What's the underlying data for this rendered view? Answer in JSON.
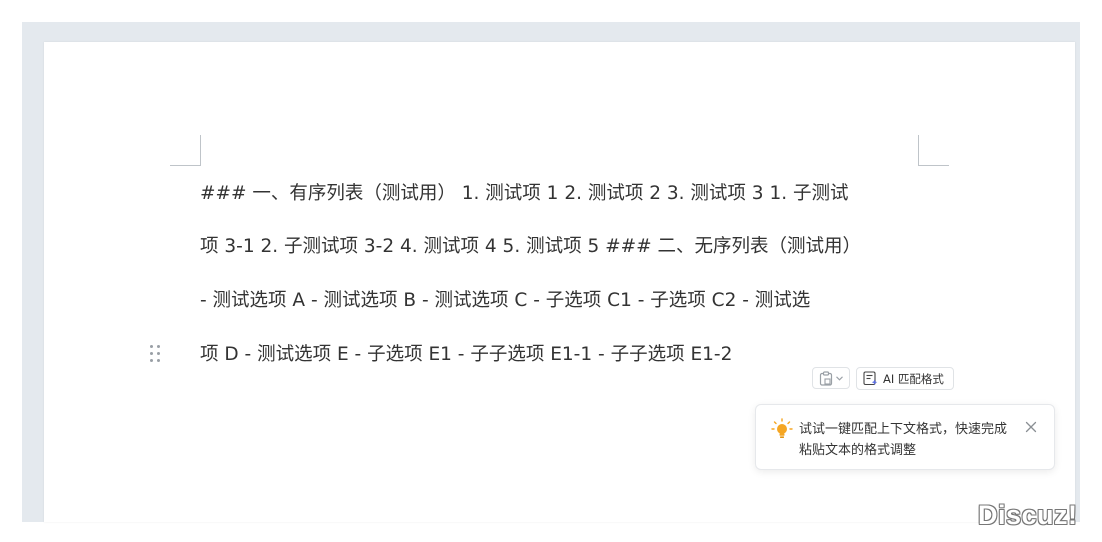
{
  "document": {
    "lines": [
      "### 一、有序列表（测试用） 1. 测试项 1 2. 测试项 2 3. 测试项 3 1. 子测试",
      "项 3-1 2. 子测试项 3-2 4. 测试项 4 5. 测试项 5 ### 二、无序列表（测试用）",
      "- 测试选项 A - 测试选项 B - 测试选项 C - 子选项 C1 - 子选项 C2 - 测试选",
      "项 D - 测试选项 E - 子选项 E1 - 子子选项 E1-1 - 子子选项 E1-2"
    ]
  },
  "paste_toolbar": {
    "paste_icon": "clipboard-icon",
    "dropdown_icon": "chevron-down-icon",
    "ai_button_label": "AI 匹配格式",
    "ai_icon": "ai-format-icon"
  },
  "tooltip": {
    "icon": "lightbulb-icon",
    "text": "试试一键匹配上下文格式，快速完成粘贴文本的格式调整",
    "close_icon": "close-icon"
  },
  "watermark": {
    "text": "Discuz!"
  },
  "colors": {
    "canvas_bg": "#e4e9ee",
    "text": "#333333",
    "bulb": "#f5a623",
    "ai_accent": "#5b6ee1"
  }
}
